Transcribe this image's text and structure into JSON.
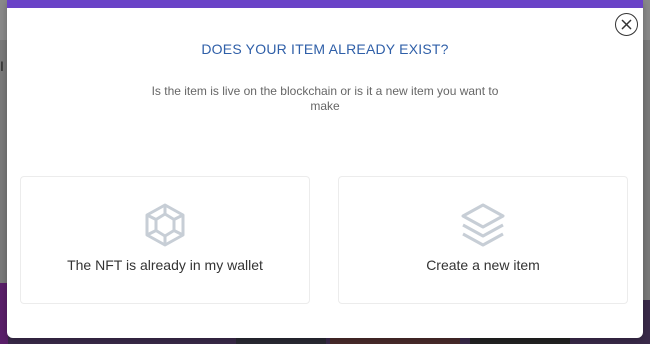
{
  "background": {
    "left_char": "I"
  },
  "modal": {
    "title": "DOES YOUR ITEM ALREADY EXIST?",
    "subtitle": "Is the item is live on the blockchain or is it a new item you want to make",
    "close_icon": "close-circle-icon",
    "accent_color": "#6a43c7",
    "title_color": "#2f5fa8"
  },
  "options": [
    {
      "label": "The NFT is already in my wallet",
      "icon": "cube-outline-icon"
    },
    {
      "label": "Create a new item",
      "icon": "layers-icon"
    }
  ]
}
